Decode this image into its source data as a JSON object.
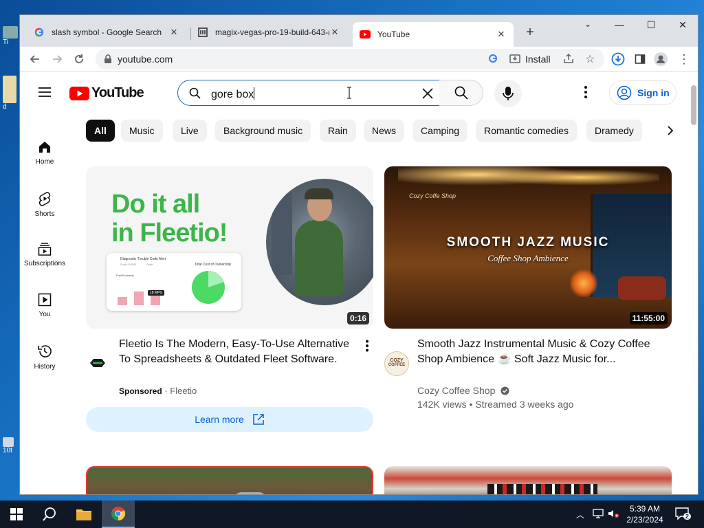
{
  "desktop": {
    "icon_label_1": "Ti",
    "icon_label_2": "d",
    "icon_label_3": "10t"
  },
  "browser": {
    "tabs": [
      {
        "title": "slash symbol - Google Search",
        "active": false
      },
      {
        "title": "magix-vegas-pro-19-build-643-(",
        "active": false
      },
      {
        "title": "YouTube",
        "active": true
      }
    ],
    "address": "youtube.com",
    "install_label": "Install"
  },
  "youtube": {
    "logo_text": "YouTube",
    "search": {
      "query": "gore box"
    },
    "signin_label": "Sign in",
    "sidebar": [
      {
        "label": "Home",
        "icon": "home-icon"
      },
      {
        "label": "Shorts",
        "icon": "shorts-icon"
      },
      {
        "label": "Subscriptions",
        "icon": "subscriptions-icon"
      },
      {
        "label": "You",
        "icon": "you-icon"
      },
      {
        "label": "History",
        "icon": "history-icon"
      }
    ],
    "chips": [
      "All",
      "Music",
      "Live",
      "Background music",
      "Rain",
      "News",
      "Camping",
      "Romantic comedies",
      "Dramedy"
    ],
    "videos": [
      {
        "title_line1": "Fleetio Is The Modern, Easy-To-Use Alternative",
        "title_line2": "To Spreadsheets & Outdated Fleet Software.",
        "sponsored": "Sponsored",
        "sep": "·",
        "channel": "Fleetio",
        "duration": "0:16",
        "cta": "Learn more",
        "thumb_headline_1": "Do it all",
        "thumb_headline_2": "in Fleetio!",
        "thumb_small_1": "Diagnostic Trouble Code Alert",
        "thumb_small_2": "Total Cost of Ownership",
        "thumb_small_3": "Fuel Economy",
        "thumb_small_4": "18 MPG",
        "thumb_small_5": "Code: P0303",
        "thumb_small_6": "Open"
      },
      {
        "title_line1": "Smooth Jazz Instrumental Music & Cozy Coffee",
        "title_line2": "Shop Ambience ☕ Soft Jazz Music for...",
        "channel": "Cozy Coffee Shop",
        "stats": "142K views • Streamed 3 weeks ago",
        "duration": "11:55:00",
        "thumb_headline_1": "SMOOTH JAZZ MUSIC",
        "thumb_headline_2": "Coffee Shop Ambience",
        "thumb_sign": "Cozy Coffe Shop",
        "avatar_text_1": "COZY",
        "avatar_text_2": "COFFEE"
      }
    ]
  },
  "taskbar": {
    "time": "5:39 AM",
    "date": "2/23/2024",
    "notifications": "2"
  }
}
